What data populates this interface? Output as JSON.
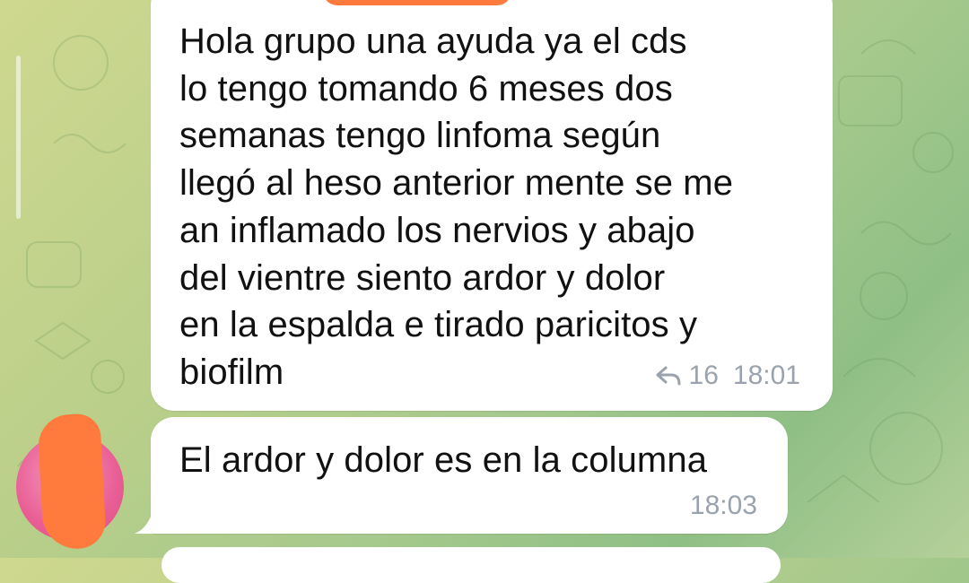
{
  "chat": {
    "messages": [
      {
        "text": "Hola grupo una ayuda ya el cds\nlo tengo tomando 6 meses dos\nsemanas tengo linfoma según\nllegó al heso anterior mente se me\nan inflamado los nervios y abajo\ndel vientre siento ardor y dolor\nen la espalda e tirado paricitos y\nbiofilm",
        "reply_count": "16",
        "time": "18:01"
      },
      {
        "text": "El ardor y dolor es en la columna",
        "time": "18:03"
      }
    ]
  },
  "colors": {
    "bubble": "#ffffff",
    "meta_text": "#9aa3ad",
    "redaction": "#ff7a3d",
    "avatar": "#e95e95"
  },
  "icons": {
    "reply": "reply-arrow-icon"
  }
}
